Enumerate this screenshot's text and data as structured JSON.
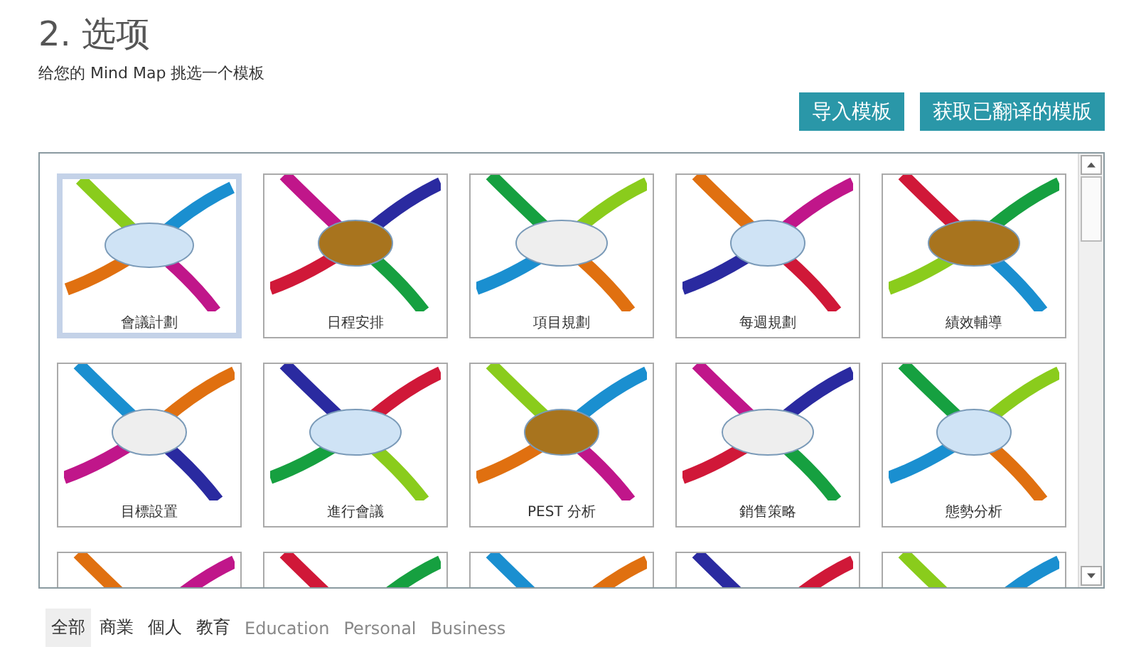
{
  "header": {
    "title": "2. 选项",
    "subtitle": "给您的 Mind Map 挑选一个模板"
  },
  "buttons": [
    "导入模板",
    "获取已翻译的模版"
  ],
  "templates": [
    {
      "label": "會議計劃",
      "selected": true
    },
    {
      "label": "日程安排",
      "selected": false
    },
    {
      "label": "項目規劃",
      "selected": false
    },
    {
      "label": "每週規劃",
      "selected": false
    },
    {
      "label": "績效輔導",
      "selected": false
    },
    {
      "label": "目標設置",
      "selected": false
    },
    {
      "label": "進行會議",
      "selected": false
    },
    {
      "label": "PEST 分析",
      "selected": false
    },
    {
      "label": "銷售策略",
      "selected": false
    },
    {
      "label": "態勢分析",
      "selected": false
    },
    {
      "selected": false
    },
    {
      "selected": false
    },
    {
      "selected": false
    },
    {
      "selected": false
    },
    {
      "selected": false
    }
  ],
  "filters": [
    {
      "label": "全部",
      "selected": true,
      "kind": "category"
    },
    {
      "label": "商業",
      "selected": false,
      "kind": "category"
    },
    {
      "label": "個人",
      "selected": false,
      "kind": "category"
    },
    {
      "label": "教育",
      "selected": false,
      "kind": "category"
    },
    {
      "label": "Education",
      "selected": false,
      "kind": "language"
    },
    {
      "label": "Personal",
      "selected": false,
      "kind": "language"
    },
    {
      "label": "Business",
      "selected": false,
      "kind": "language"
    }
  ]
}
